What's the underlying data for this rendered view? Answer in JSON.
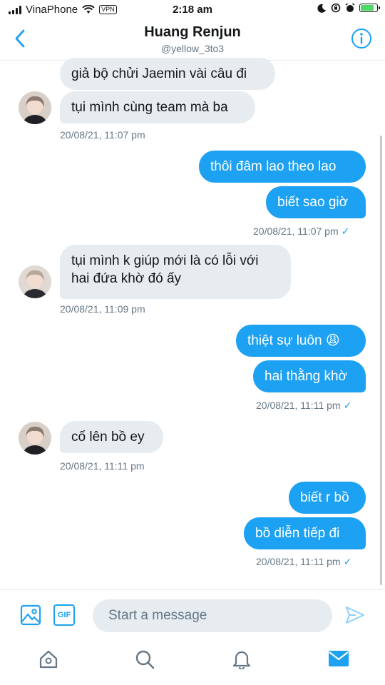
{
  "status_bar": {
    "carrier": "VinaPhone",
    "vpn": "VPN",
    "time": "2:18 am"
  },
  "header": {
    "name": "Huang Renjun",
    "handle": "@yellow_3to3"
  },
  "messages": [
    {
      "side": "in",
      "text": "giả bộ chửi Jaemin vài câu đi"
    },
    {
      "side": "in",
      "text": "tụi mình cùng team mà ba"
    },
    {
      "side": "in-ts",
      "text": "20/08/21, 11:07 pm"
    },
    {
      "side": "out",
      "text": "thôi đâm lao theo lao"
    },
    {
      "side": "out",
      "text": "biết sao giờ"
    },
    {
      "side": "out-ts",
      "text": "20/08/21, 11:07 pm"
    },
    {
      "side": "in",
      "text": "tụi mình k giúp mới là có lỗi với"
    },
    {
      "side": "in",
      "text": "hai đứa khờ đó ấy"
    },
    {
      "side": "in-ts",
      "text": "20/08/21, 11:09 pm"
    },
    {
      "side": "out",
      "text": "thiệt sự luôn 😩"
    },
    {
      "side": "out",
      "text": "hai thằng khờ"
    },
    {
      "side": "out-ts",
      "text": "20/08/21, 11:11 pm"
    },
    {
      "side": "in",
      "text": "cố lên bồ ey"
    },
    {
      "side": "in-ts",
      "text": "20/08/21, 11:11 pm"
    },
    {
      "side": "out",
      "text": "biết r bồ"
    },
    {
      "side": "out",
      "text": "bồ diễn tiếp đi"
    },
    {
      "side": "out-ts",
      "text": "20/08/21, 11:11 pm"
    }
  ],
  "compose": {
    "placeholder": "Start a message",
    "gif_label": "GIF"
  },
  "icons": {
    "back": "chevron-left-icon",
    "info": "info-icon",
    "image": "image-icon",
    "gif": "gif-icon",
    "send": "send-icon",
    "home": "home-icon",
    "search": "search-icon",
    "notifications": "bell-icon",
    "messages": "mail-icon"
  },
  "colors": {
    "accent": "#1da1f2",
    "incoming_bubble": "#e6ecf0",
    "secondary_text": "#657786"
  }
}
